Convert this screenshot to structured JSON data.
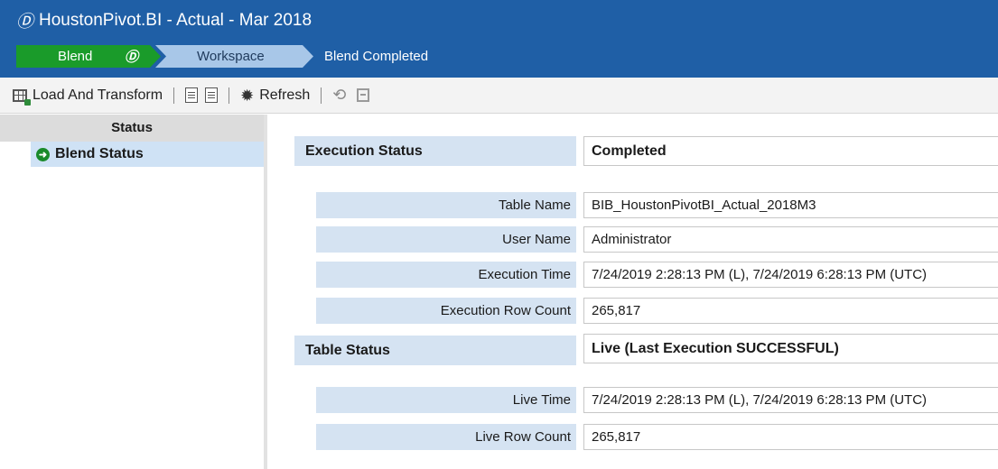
{
  "window": {
    "title": "HoustonPivot.BI  -  Actual  -  Mar 2018",
    "logo_glyph": "Ⓓ"
  },
  "breadcrumbs": {
    "blend": "Blend",
    "blend_icon": "Ⓓ",
    "workspace": "Workspace",
    "status": "Blend Completed"
  },
  "toolbar": {
    "load_transform": "Load And Transform",
    "refresh": "Refresh"
  },
  "sidebar": {
    "header": "Status",
    "items": [
      {
        "label": "Blend Status",
        "icon": "arrow-circle-right-icon"
      }
    ]
  },
  "execution": {
    "section_label": "Execution Status",
    "section_value": "Completed",
    "rows": [
      {
        "label": "Table Name",
        "value": "BIB_HoustonPivotBI_Actual_2018M3"
      },
      {
        "label": "User Name",
        "value": "Administrator"
      },
      {
        "label": "Execution Time",
        "value": "7/24/2019 2:28:13 PM (L), 7/24/2019 6:28:13 PM (UTC)"
      },
      {
        "label": "Execution Row Count",
        "value": "265,817"
      }
    ]
  },
  "table_status": {
    "section_label": "Table Status",
    "section_value": "Live (Last Execution SUCCESSFUL)",
    "rows": [
      {
        "label": "Live Time",
        "value": "7/24/2019 2:28:13 PM (L), 7/24/2019 6:28:13 PM (UTC)"
      },
      {
        "label": "Live Row Count",
        "value": "265,817"
      }
    ]
  },
  "colors": {
    "titlebar": "#1f5fa6",
    "blend_crumb": "#1a9b2a",
    "workspace_crumb": "#a8c7e8",
    "label_bg": "#d5e3f2"
  }
}
